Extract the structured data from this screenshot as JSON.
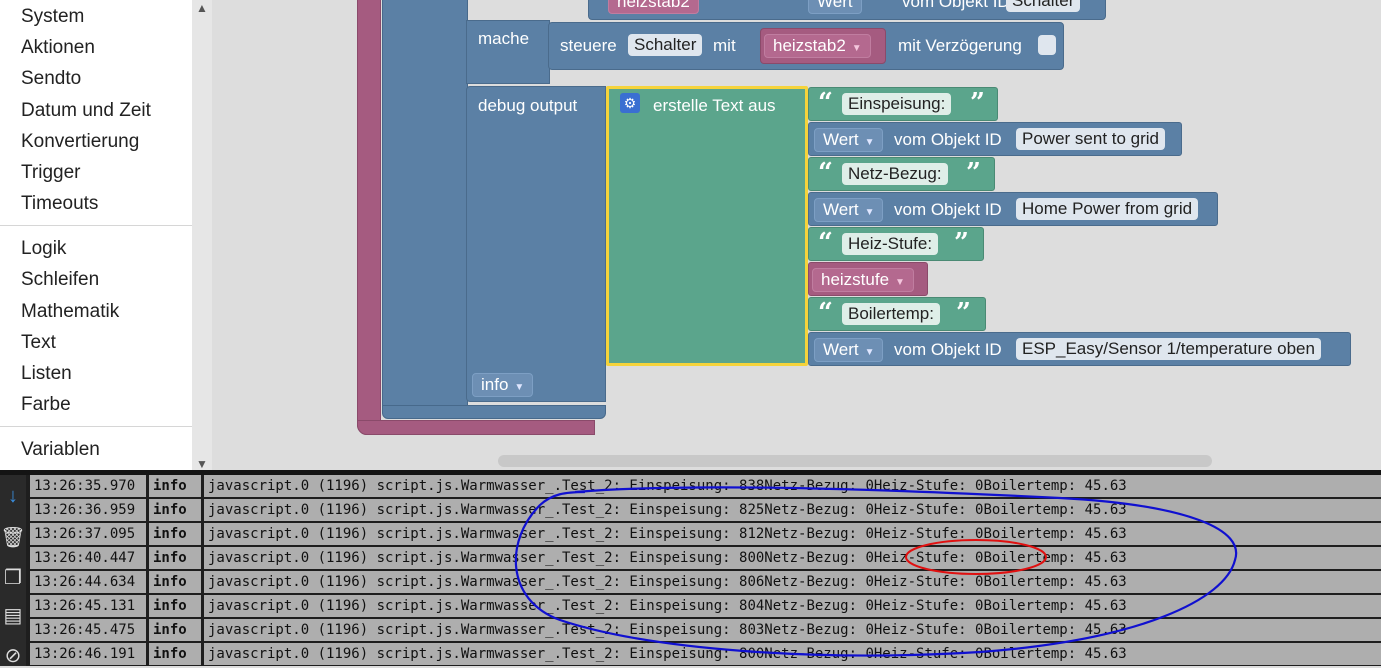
{
  "sidebar": {
    "categories": [
      "System",
      "Aktionen",
      "Sendto",
      "Datum und Zeit",
      "Konvertierung",
      "Trigger",
      "Timeouts",
      "Logik",
      "Schleifen",
      "Mathematik",
      "Text",
      "Listen",
      "Farbe",
      "Variablen"
    ]
  },
  "blocks": {
    "top_partial": {
      "var": "heizstab2",
      "wert": "Wert",
      "vom": "vom Objekt ID",
      "obj": "Schalter"
    },
    "mache": "mache",
    "steuere": {
      "label": "steuere",
      "target": "Schalter",
      "mit": "mit",
      "var": "heizstab2",
      "delay_label": "mit Verzögerung"
    },
    "debug": {
      "label": "debug output",
      "create_text": "erstelle Text aus",
      "level": "info"
    },
    "items": [
      {
        "kind": "text",
        "value": "Einspeisung:"
      },
      {
        "kind": "obj",
        "wert": "Wert",
        "vom": "vom Objekt ID",
        "id": "Power sent to grid"
      },
      {
        "kind": "text",
        "value": "Netz-Bezug:"
      },
      {
        "kind": "obj",
        "wert": "Wert",
        "vom": "vom Objekt ID",
        "id": "Home Power from grid"
      },
      {
        "kind": "text",
        "value": "Heiz-Stufe:"
      },
      {
        "kind": "var",
        "value": "heizstufe"
      },
      {
        "kind": "text",
        "value": "Boilertemp:"
      },
      {
        "kind": "obj",
        "wert": "Wert",
        "vom": "vom Objekt ID",
        "id": "ESP_Easy/Sensor 1/temperature oben"
      }
    ]
  },
  "log": {
    "rows": [
      {
        "time": "13:26:35.970",
        "severity": "info",
        "message": "javascript.0 (1196) script.js.Warmwasser_.Test_2: Einspeisung: 838Netz-Bezug: 0Heiz-Stufe: 0Boilertemp: 45.63"
      },
      {
        "time": "13:26:36.959",
        "severity": "info",
        "message": "javascript.0 (1196) script.js.Warmwasser_.Test_2: Einspeisung: 825Netz-Bezug: 0Heiz-Stufe: 0Boilertemp: 45.63"
      },
      {
        "time": "13:26:37.095",
        "severity": "info",
        "message": "javascript.0 (1196) script.js.Warmwasser_.Test_2: Einspeisung: 812Netz-Bezug: 0Heiz-Stufe: 0Boilertemp: 45.63"
      },
      {
        "time": "13:26:40.447",
        "severity": "info",
        "message": "javascript.0 (1196) script.js.Warmwasser_.Test_2: Einspeisung: 800Netz-Bezug: 0Heiz-Stufe: 0Boilertemp: 45.63"
      },
      {
        "time": "13:26:44.634",
        "severity": "info",
        "message": "javascript.0 (1196) script.js.Warmwasser_.Test_2: Einspeisung: 806Netz-Bezug: 0Heiz-Stufe: 0Boilertemp: 45.63"
      },
      {
        "time": "13:26:45.131",
        "severity": "info",
        "message": "javascript.0 (1196) script.js.Warmwasser_.Test_2: Einspeisung: 804Netz-Bezug: 0Heiz-Stufe: 0Boilertemp: 45.63"
      },
      {
        "time": "13:26:45.475",
        "severity": "info",
        "message": "javascript.0 (1196) script.js.Warmwasser_.Test_2: Einspeisung: 803Netz-Bezug: 0Heiz-Stufe: 0Boilertemp: 45.63"
      },
      {
        "time": "13:26:46.191",
        "severity": "info",
        "message": "javascript.0 (1196) script.js.Warmwasser_.Test_2: Einspeisung: 800Netz-Bezug: 0Heiz-Stufe: 0Boilertemp: 45.63"
      }
    ]
  },
  "toolbar_icons": [
    "scroll-down-icon",
    "trash-icon",
    "copy-icon",
    "log-list-icon",
    "hide-icon"
  ],
  "colors": {
    "logic_blue": "#5b80a5",
    "text_green": "#5ba58c",
    "variable_pink": "#a55b80",
    "selected_outline": "#f5d33b",
    "annotation_blue": "#1010d0",
    "annotation_red": "#e01010"
  }
}
